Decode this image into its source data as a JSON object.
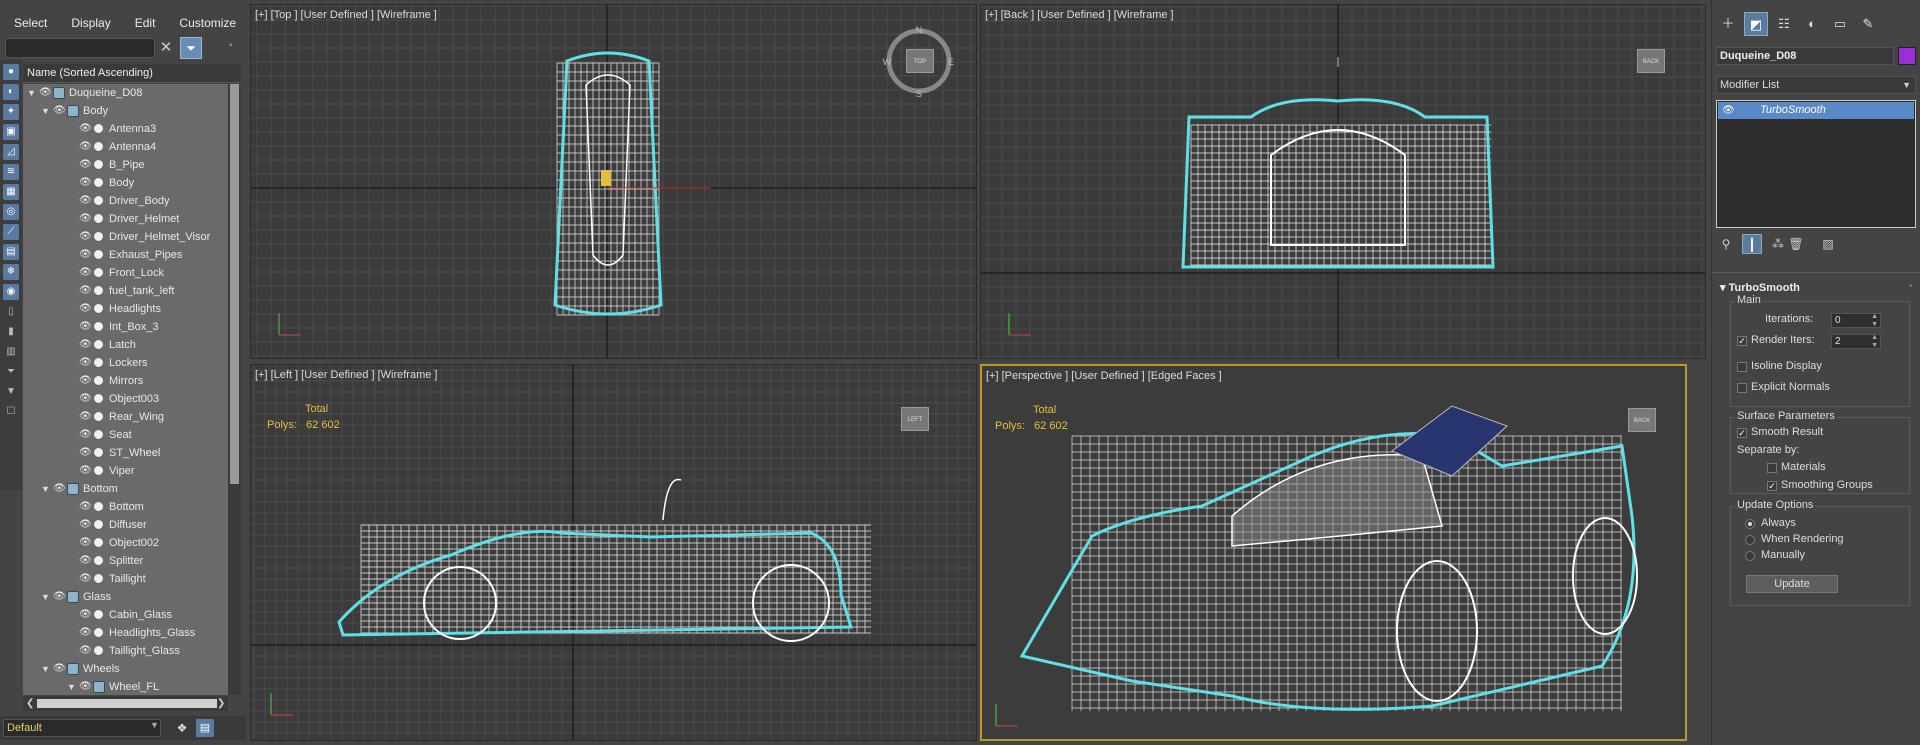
{
  "menu": [
    "Select",
    "Display",
    "Edit",
    "Customize"
  ],
  "explorer": {
    "column_header": "Name (Sorted Ascending)",
    "rows": [
      {
        "label": "Duqueine_D08",
        "level": 0,
        "kind": "layer",
        "expanded": true,
        "highlight": true
      },
      {
        "label": "Body",
        "level": 1,
        "kind": "layer",
        "expanded": true,
        "highlight": true
      },
      {
        "label": "Antenna3",
        "level": 2,
        "kind": "object",
        "highlight": true
      },
      {
        "label": "Antenna4",
        "level": 2,
        "kind": "object",
        "highlight": true
      },
      {
        "label": "B_Pipe",
        "level": 2,
        "kind": "object",
        "highlight": true
      },
      {
        "label": "Body",
        "level": 2,
        "kind": "object",
        "highlight": true
      },
      {
        "label": "Driver_Body",
        "level": 2,
        "kind": "object",
        "highlight": true
      },
      {
        "label": "Driver_Helmet",
        "level": 2,
        "kind": "object",
        "highlight": true
      },
      {
        "label": "Driver_Helmet_Visor",
        "level": 2,
        "kind": "object",
        "highlight": true
      },
      {
        "label": "Exhaust_Pipes",
        "level": 2,
        "kind": "object",
        "highlight": true
      },
      {
        "label": "Front_Lock",
        "level": 2,
        "kind": "object",
        "highlight": true
      },
      {
        "label": "fuel_tank_left",
        "level": 2,
        "kind": "object",
        "highlight": true
      },
      {
        "label": "Headlights",
        "level": 2,
        "kind": "object",
        "highlight": true
      },
      {
        "label": "Int_Box_3",
        "level": 2,
        "kind": "object",
        "highlight": true
      },
      {
        "label": "Latch",
        "level": 2,
        "kind": "object",
        "highlight": true
      },
      {
        "label": "Lockers",
        "level": 2,
        "kind": "object",
        "highlight": true
      },
      {
        "label": "Mirrors",
        "level": 2,
        "kind": "object",
        "highlight": true
      },
      {
        "label": "Object003",
        "level": 2,
        "kind": "object",
        "highlight": true
      },
      {
        "label": "Rear_Wing",
        "level": 2,
        "kind": "object",
        "highlight": true
      },
      {
        "label": "Seat",
        "level": 2,
        "kind": "object",
        "highlight": true
      },
      {
        "label": "ST_Wheel",
        "level": 2,
        "kind": "object",
        "highlight": true
      },
      {
        "label": "Viper",
        "level": 2,
        "kind": "object",
        "highlight": true
      },
      {
        "label": "Bottom",
        "level": 1,
        "kind": "layer",
        "expanded": true,
        "highlight": true
      },
      {
        "label": "Bottom",
        "level": 2,
        "kind": "object",
        "highlight": true
      },
      {
        "label": "Diffuser",
        "level": 2,
        "kind": "object",
        "highlight": true
      },
      {
        "label": "Object002",
        "level": 2,
        "kind": "object",
        "highlight": true
      },
      {
        "label": "Splitter",
        "level": 2,
        "kind": "object",
        "highlight": true
      },
      {
        "label": "Taillight",
        "level": 2,
        "kind": "object",
        "highlight": true
      },
      {
        "label": "Glass",
        "level": 1,
        "kind": "layer",
        "expanded": true,
        "highlight": true
      },
      {
        "label": "Cabin_Glass",
        "level": 2,
        "kind": "object",
        "highlight": true
      },
      {
        "label": "Headlights_Glass",
        "level": 2,
        "kind": "object",
        "highlight": true
      },
      {
        "label": "Taillight_Glass",
        "level": 2,
        "kind": "object",
        "highlight": true
      },
      {
        "label": "Wheels",
        "level": 1,
        "kind": "layer",
        "expanded": true,
        "highlight": true
      },
      {
        "label": "Wheel_FL",
        "level": 2,
        "kind": "layer",
        "expanded": true,
        "highlight": true
      }
    ],
    "layer_dropdown": "Default"
  },
  "viewports": {
    "top": {
      "label": "[+] [Top ] [User Defined ] [Wireframe ]",
      "compass": [
        "N",
        "E",
        "S",
        "W"
      ],
      "cube": "TOP"
    },
    "back": {
      "label": "[+] [Back ] [User Defined ] [Wireframe ]",
      "cube": "BACK"
    },
    "left": {
      "label": "[+] [Left ] [User Defined ] [Wireframe ]",
      "stats_title": "Total",
      "polys_label": "Polys:",
      "polys_value": "62 602",
      "cube": "LEFT"
    },
    "perspective": {
      "label": "[+] [Perspective ] [User Defined ] [Edged Faces ]",
      "stats_title": "Total",
      "polys_label": "Polys:",
      "polys_value": "62 602",
      "cube": "BACK",
      "active": true
    }
  },
  "command_panel": {
    "object_name": "Duqueine_D08",
    "object_color": "#9b2fd6",
    "modifier_list": "Modifier List",
    "stack_item": "TurboSmooth",
    "rollout_title": "TurboSmooth",
    "main_group": "Main",
    "iterations_label": "Iterations:",
    "iterations_value": "0",
    "render_iters_label": "Render Iters:",
    "render_iters_value": "2",
    "render_iters_checked": true,
    "isoline_label": "Isoline Display",
    "isoline_checked": false,
    "explicit_label": "Explicit Normals",
    "explicit_checked": false,
    "surface_group": "Surface Parameters",
    "smooth_result_label": "Smooth Result",
    "smooth_result_checked": true,
    "separate_by": "Separate by:",
    "materials_label": "Materials",
    "materials_checked": false,
    "smoothing_groups_label": "Smoothing Groups",
    "smoothing_groups_checked": true,
    "update_group": "Update Options",
    "always_label": "Always",
    "when_rendering_label": "When Rendering",
    "manually_label": "Manually",
    "update_mode": "Always",
    "update_button": "Update"
  },
  "colors": {
    "accent": "#5a7aa0",
    "selection_wire": "#5fe0e6",
    "active_border": "#b89a25",
    "stats_text": "#e0c040"
  }
}
